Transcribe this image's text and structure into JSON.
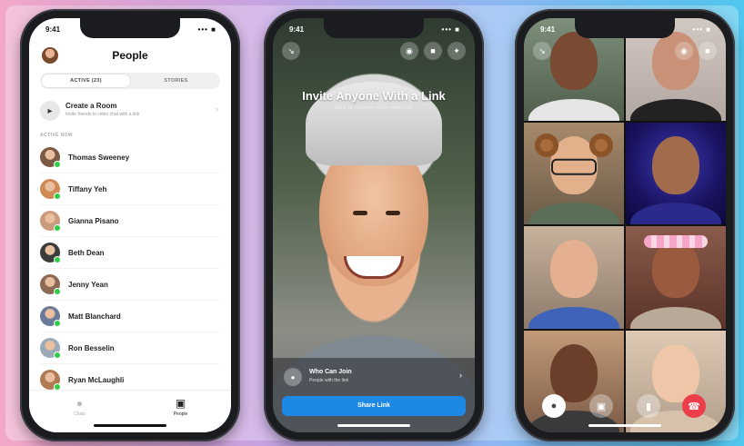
{
  "phone1": {
    "status_time": "9:41",
    "status_right": "••• ■",
    "title": "People",
    "tabs": [
      "ACTIVE (23)",
      "STORIES"
    ],
    "room": {
      "title": "Create a Room",
      "subtitle": "Invite friends to video chat with a link",
      "chevron": "›"
    },
    "section_label": "ACTIVE NOW",
    "contacts": [
      {
        "name": "Thomas Sweeney",
        "color": "#7a5a45"
      },
      {
        "name": "Tiffany Yeh",
        "color": "#d08a55"
      },
      {
        "name": "Gianna Pisano",
        "color": "#c99a7d"
      },
      {
        "name": "Beth Dean",
        "color": "#3c3c3c"
      },
      {
        "name": "Jenny Yean",
        "color": "#8c6a56"
      },
      {
        "name": "Matt Blanchard",
        "color": "#6b7a9a"
      },
      {
        "name": "Ron Besselin",
        "color": "#9aaab7"
      },
      {
        "name": "Ryan McLaughli",
        "color": "#b07a55"
      }
    ],
    "bottom_tabs": [
      {
        "icon": "●",
        "label": "Chats"
      },
      {
        "icon": "▣",
        "label": "People"
      }
    ]
  },
  "phone2": {
    "status_time": "9:41",
    "status_right": "••• ■",
    "title": "Invite Anyone With a Link",
    "subtitle": "We'll let you know when others join",
    "who_title": "Who Can Join",
    "who_subtitle": "People with the link",
    "chevron": "›",
    "share_label": "Share Link"
  },
  "phone3": {
    "status_time": "9:41",
    "status_right": "••• ■"
  },
  "colors": {
    "messenger_blue": "#1e88e5",
    "online_green": "#31cc46",
    "end_call_red": "#ec3d4b"
  }
}
